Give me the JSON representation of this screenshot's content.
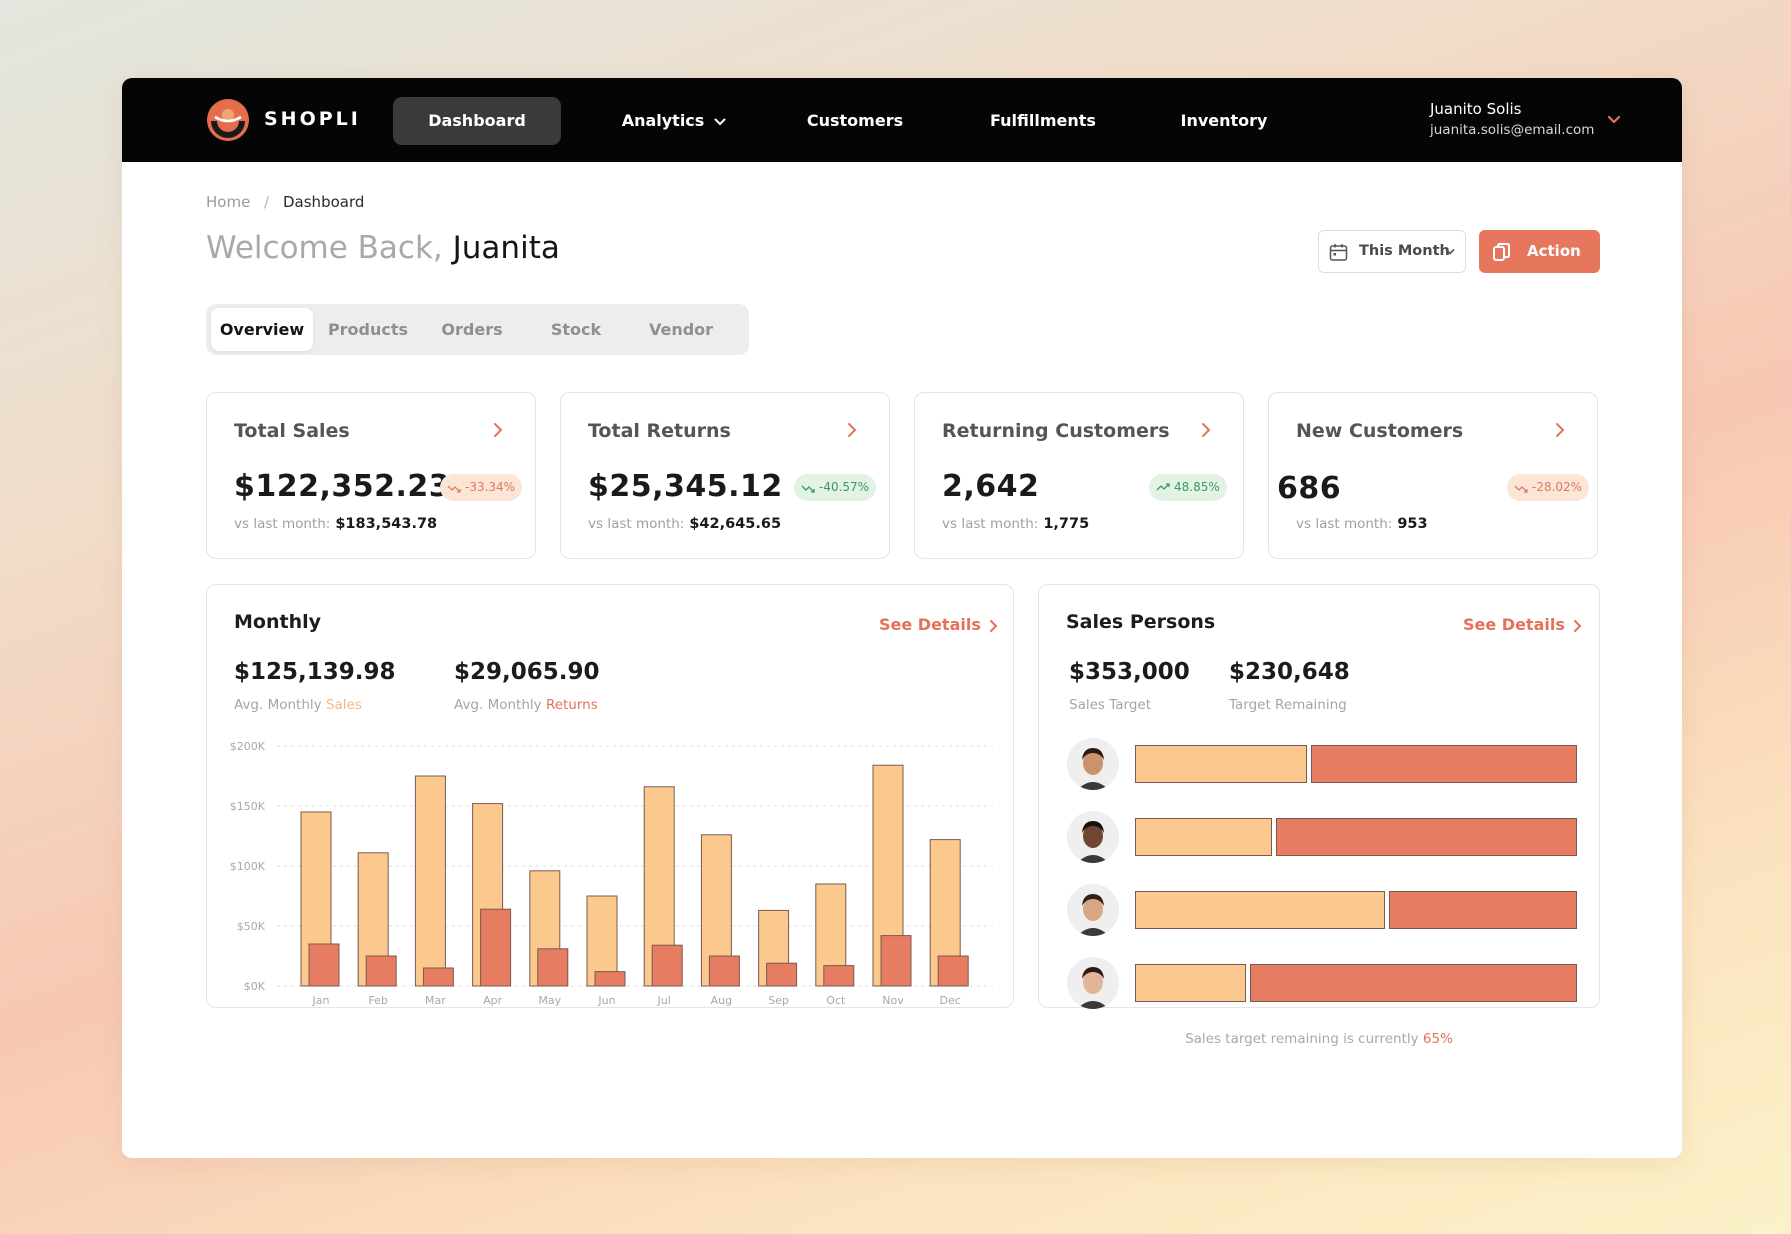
{
  "brand": {
    "name": "SHOPLI"
  },
  "nav": {
    "items": [
      {
        "label": "Dashboard",
        "active": true
      },
      {
        "label": "Analytics",
        "has_dropdown": true
      },
      {
        "label": "Customers"
      },
      {
        "label": "Fulfillments"
      },
      {
        "label": "Inventory"
      }
    ],
    "user": {
      "name": "Juanito Solis",
      "email": "juanita.solis@email.com"
    }
  },
  "breadcrumb": {
    "home": "Home",
    "separator": "/",
    "current": "Dashboard"
  },
  "header": {
    "welcome_prefix": "Welcome Back,",
    "welcome_name": "Juanita",
    "date_filter": "This Month",
    "action_label": "Action"
  },
  "tabs": [
    {
      "label": "Overview",
      "active": true
    },
    {
      "label": "Products"
    },
    {
      "label": "Orders"
    },
    {
      "label": "Stock"
    },
    {
      "label": "Vendor"
    }
  ],
  "stats": [
    {
      "title": "Total Sales",
      "value": "$122,352.23",
      "change": "-33.34%",
      "trend": "negative",
      "prev_label": "vs last month:",
      "prev_value": "$183,543.78"
    },
    {
      "title": "Total Returns",
      "value": "$25,345.12",
      "change": "-40.57%",
      "trend": "positive",
      "prev_label": "vs last month:",
      "prev_value": "$42,645.65"
    },
    {
      "title": "Returning Customers",
      "value": "2,642",
      "change": "48.85%",
      "trend": "positive",
      "prev_label": "vs last month:",
      "prev_value": "1,775"
    },
    {
      "title": "New Customers",
      "value": "686",
      "change": "-28.02%",
      "trend": "negative",
      "prev_label": "vs last month:",
      "prev_value": "953"
    }
  ],
  "monthly": {
    "title": "Monthly",
    "see_details": "See Details",
    "avg_sales_value": "$125,139.98",
    "avg_sales_label": "Avg. Monthly",
    "avg_sales_highlight": "Sales",
    "avg_returns_value": "$29,065.90",
    "avg_returns_label": "Avg. Monthly",
    "avg_returns_highlight": "Returns"
  },
  "sales_persons": {
    "title": "Sales Persons",
    "see_details": "See Details",
    "target_value": "$353,000",
    "target_label": "Sales Target",
    "remaining_value": "$230,648",
    "remaining_label": "Target Remaining",
    "footer_text": "Sales target remaining is currently",
    "footer_pct": "65%",
    "persons": [
      {
        "progress": 0.39,
        "avatar_skin": "#c9936d",
        "avatar_hair": "#2b1b14"
      },
      {
        "progress": 0.31,
        "avatar_skin": "#6e4632",
        "avatar_hair": "#1a110c"
      },
      {
        "progress": 0.565,
        "avatar_skin": "#d8a784",
        "avatar_hair": "#2f2019"
      },
      {
        "progress": 0.25,
        "avatar_skin": "#e2b596",
        "avatar_hair": "#2a1c15"
      }
    ]
  },
  "colors": {
    "accent": "#e6775d",
    "sales_bar": "#fbc98e",
    "returns_bar": "#e67c61"
  },
  "chart_data": {
    "type": "bar",
    "categories": [
      "Jan",
      "Feb",
      "Mar",
      "Apr",
      "May",
      "Jun",
      "Jul",
      "Aug",
      "Sep",
      "Oct",
      "Nov",
      "Dec"
    ],
    "series": [
      {
        "name": "Sales",
        "values": [
          145000,
          111000,
          175000,
          152000,
          96000,
          75000,
          166000,
          126000,
          63000,
          85000,
          184000,
          122000
        ]
      },
      {
        "name": "Returns",
        "values": [
          35000,
          25000,
          15000,
          64000,
          31000,
          12000,
          34000,
          25000,
          19000,
          17000,
          42000,
          25000
        ]
      }
    ],
    "ylim": [
      0,
      200000
    ],
    "yticks": [
      "$0K",
      "$50K",
      "$100K",
      "$150K",
      "$200K"
    ],
    "ytick_values": [
      0,
      50000,
      100000,
      150000,
      200000
    ],
    "grid": true
  }
}
